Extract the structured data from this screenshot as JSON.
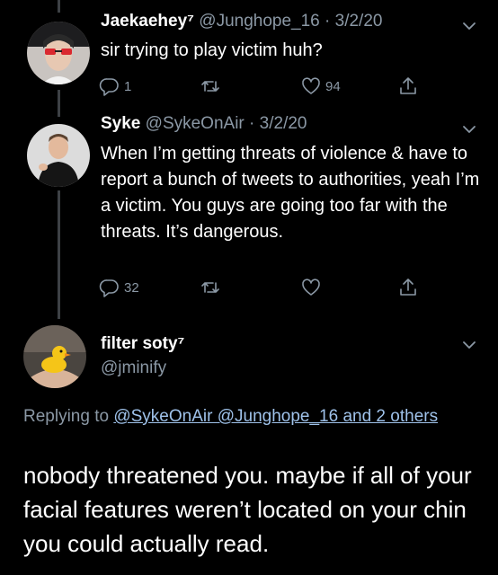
{
  "tweets": [
    {
      "name": "Jaekaehey",
      "name_suffix": "⁷",
      "handle": "@Junghope_16",
      "date": "· 3/2/20",
      "text": "sir trying to play victim huh?",
      "replies": "1",
      "retweets": "",
      "likes": "94"
    },
    {
      "name": "Syke",
      "handle": "@SykeOnAir",
      "date": "· 3/2/20",
      "text": "When I’m getting threats of violence & have to report a bunch of tweets to authorities, yeah I’m a victim. You guys are going too far with the threats. It’s dangerous.",
      "replies": "32",
      "retweets": "",
      "likes": ""
    }
  ],
  "main_tweet": {
    "name": "filter soty⁷",
    "handle": "@jminify",
    "replying_prefix": "Replying to",
    "replying_mentions": "@SykeOnAir @Junghope_16 and 2 others",
    "text": "nobody threatened you. maybe if all of your facial features weren’t located on your chin you could actually read."
  },
  "icons": {
    "reply": "reply-icon",
    "retweet": "retweet-icon",
    "like": "heart-icon",
    "share": "share-icon",
    "more": "chevron-down-icon"
  },
  "colors": {
    "background": "#000000",
    "text": "#ffffff",
    "secondary": "#8b98a5",
    "link": "#9fc2ea"
  }
}
